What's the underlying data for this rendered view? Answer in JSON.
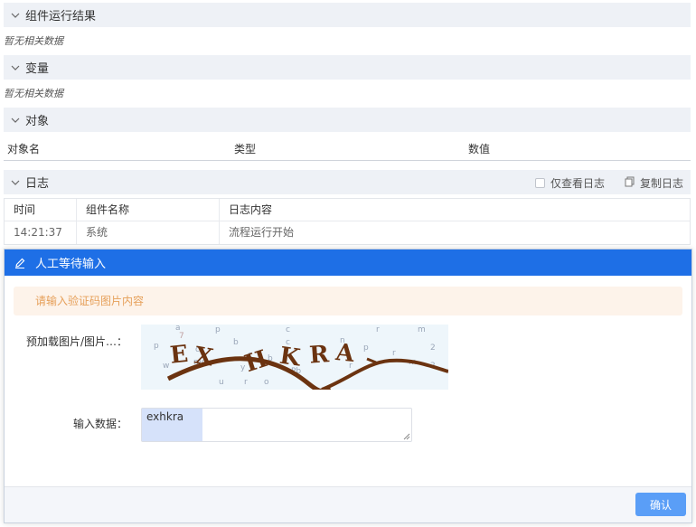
{
  "sections": {
    "results": {
      "title": "组件运行结果",
      "empty": "暂无相关数据"
    },
    "variables": {
      "title": "变量",
      "empty": "暂无相关数据"
    },
    "objects": {
      "title": "对象",
      "columns": [
        "对象名",
        "类型",
        "数值"
      ]
    },
    "log": {
      "title": "日志",
      "only_view_label": "仅查看日志",
      "copy_label": "复制日志",
      "columns": [
        "时间",
        "组件名称",
        "日志内容"
      ],
      "rows": [
        {
          "time": "14:21:37",
          "component": "系统",
          "content": "流程运行开始"
        }
      ]
    }
  },
  "dialog": {
    "title": "人工等待输入",
    "alert": "请输入验证码图片内容",
    "image_label": "预加载图片/图片…：",
    "input_label": "输入数据：",
    "input_value": "exhkra",
    "captcha_text": "EXHKRA",
    "confirm_label": "确认"
  },
  "colors": {
    "header_bg": "#eef1f6",
    "dialog_title_bg": "#1e6fe6",
    "alert_bg": "#fdf3ea",
    "alert_text": "#e6a05a",
    "button_bg": "#5a9ef7"
  }
}
